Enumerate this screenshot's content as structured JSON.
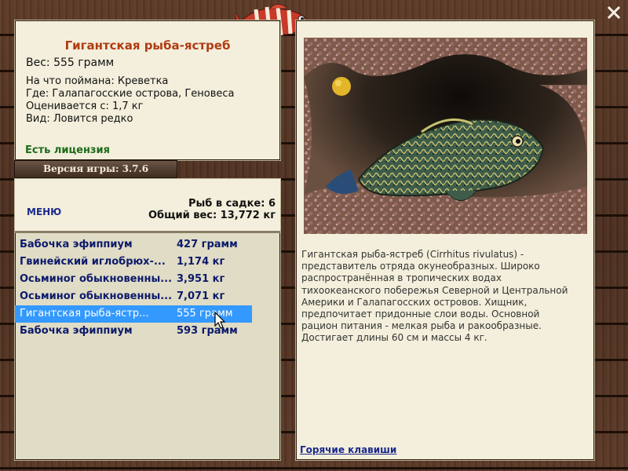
{
  "fish": {
    "title": "Гигантская рыба-ястреб",
    "weight": "Вес: 555 грамм",
    "bait": "На что поймана: Креветка",
    "location": "Где: Галапагосские острова, Геновеса",
    "estimated": "Оценивается с: 1,7 кг",
    "kind": "Вид: Ловится редко",
    "license": "Есть лицензия"
  },
  "version": "Версия игры: 3.7.6",
  "catch": {
    "menu_label": "МЕНЮ",
    "count": "Рыб в садке: 6",
    "total_weight": "Общий вес: 13,772 кг",
    "rows": [
      {
        "name": "Бабочка эфиппиум",
        "weight": "427 грамм",
        "selected": false
      },
      {
        "name": "Гвинейский иглобрюх-...",
        "weight": "1,174 кг",
        "selected": false
      },
      {
        "name": "Осьминог обыкновенны...",
        "weight": "3,951 кг",
        "selected": false
      },
      {
        "name": "Осьминог обыкновенны...",
        "weight": "7,071 кг",
        "selected": false
      },
      {
        "name": "Гигантская рыба-ястр...",
        "weight": "555 грамм",
        "selected": true
      },
      {
        "name": "Бабочка эфиппиум",
        "weight": "593 грамм",
        "selected": false
      }
    ],
    "selected_color": "#3399ff"
  },
  "detail": {
    "description": "Гигантская рыба-ястреб (Cirrhitus rivulatus) - представитель отряда окунеобразных. Широко распространённая в тропических водах тихоокеанского побережья Северной и Центральной Америки и Галапагосских островов. Хищник, предпочитает придонные слои воды. Основной рацион питания - мелкая рыба и ракообразные. Достигает длины 60 см и массы 4 кг.",
    "hotkeys_label": "Горячие клавиши"
  },
  "colors": {
    "title": "#b13b12",
    "license": "#1e6b1a",
    "list_text": "#0c1a6b",
    "panel_bg": "#f3efdc"
  },
  "icons": [
    "fish-logo-icon",
    "close-icon",
    "cursor-icon"
  ]
}
